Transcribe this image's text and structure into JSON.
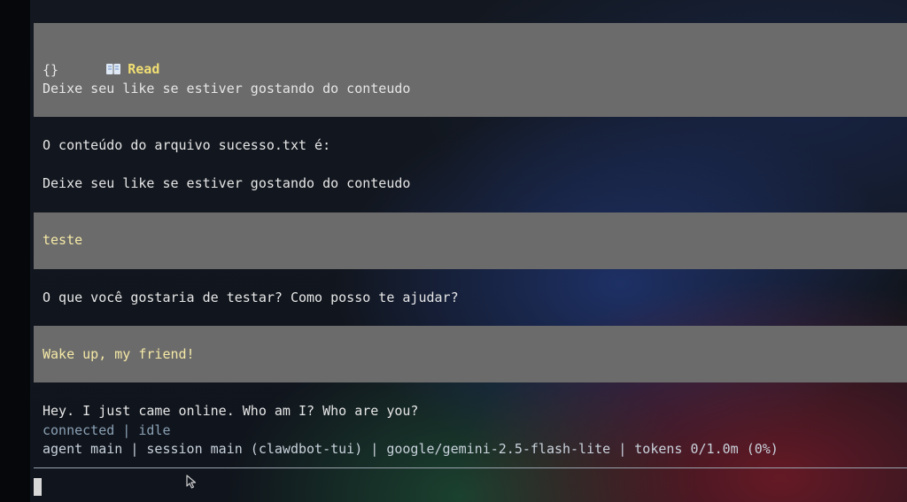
{
  "tool_block": {
    "icon": "book-icon",
    "title": "Read",
    "args": "{}",
    "output": "Deixe seu like se estiver gostando do conteudo"
  },
  "assistant_1": {
    "line1": "O conteúdo do arquivo sucesso.txt é:",
    "line2": "Deixe seu like se estiver gostando do conteudo"
  },
  "user_1": {
    "text": "teste"
  },
  "assistant_2": {
    "text": "O que você gostaria de testar? Como posso te ajudar?"
  },
  "user_2": {
    "text": "Wake up, my friend!"
  },
  "assistant_3": {
    "text": "Hey. I just came online. Who am I? Who are you?"
  },
  "status": {
    "connection": "connected | idle",
    "info": "agent main | session main (clawdbot-tui) | google/gemini-2.5-flash-lite | tokens 0/1.0m (0%)"
  },
  "colors": {
    "message_background": "#6b6b6b",
    "tool_title": "#f1df73",
    "user_text": "#f5e9a6",
    "muted_text": "#8aa0b4"
  }
}
